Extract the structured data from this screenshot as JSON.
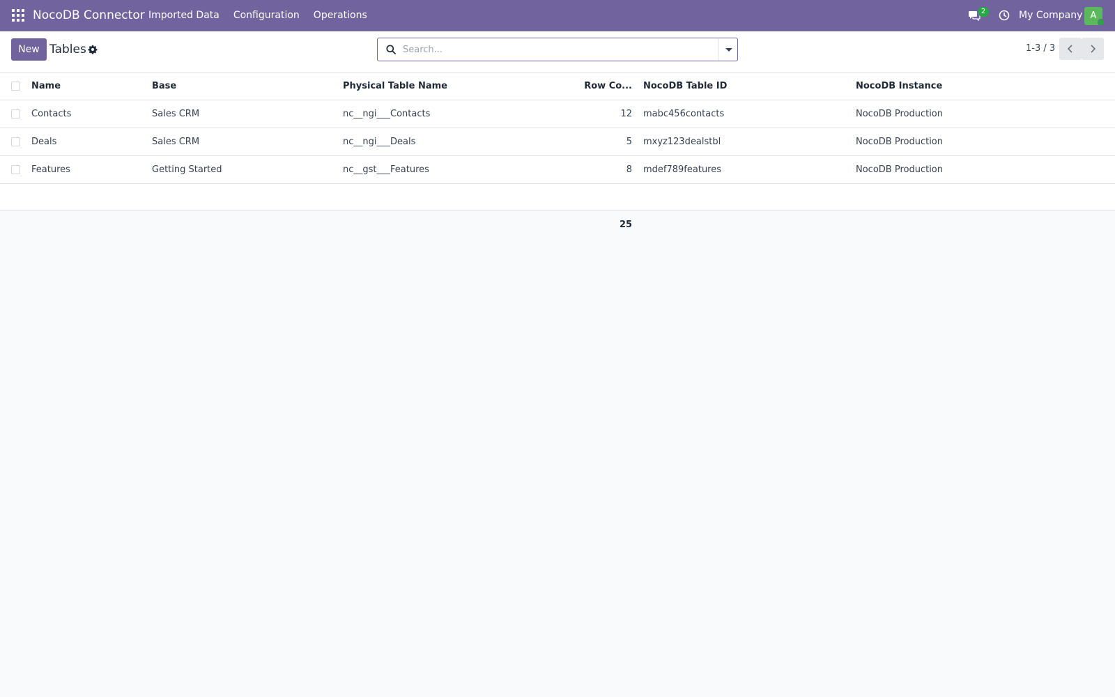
{
  "navbar": {
    "brand": "NocoDB Connector",
    "menu": [
      "Imported Data",
      "Configuration",
      "Operations"
    ],
    "chat_badge": "2",
    "company": "My Company",
    "avatar_letter": "A"
  },
  "control_panel": {
    "new_label": "New",
    "breadcrumb": "Tables",
    "search_placeholder": "Search...",
    "pager": "1-3 / 3"
  },
  "table": {
    "columns": [
      "Name",
      "Base",
      "Physical Table Name",
      "Row Co...",
      "NocoDB Table ID",
      "NocoDB Instance"
    ],
    "rows": [
      [
        "Contacts",
        "Sales CRM",
        "nc__ngi___Contacts",
        "12",
        "mabc456contacts",
        "NocoDB Production"
      ],
      [
        "Deals",
        "Sales CRM",
        "nc__ngi___Deals",
        "5",
        "mxyz123dealstbl",
        "NocoDB Production"
      ],
      [
        "Features",
        "Getting Started",
        "nc__gst___Features",
        "8",
        "mdef789features",
        "NocoDB Production"
      ]
    ],
    "row_count_total": "25"
  },
  "colors": {
    "navbar": "#71639e",
    "primary": "#71639e",
    "badge": "#28a745",
    "avatar": "#5cb85c"
  },
  "icons": [
    "apps-grid-icon",
    "chat-icon",
    "clock-icon",
    "gear-icon",
    "search-icon",
    "caret-down-icon",
    "chevron-left-icon",
    "chevron-right-icon"
  ]
}
